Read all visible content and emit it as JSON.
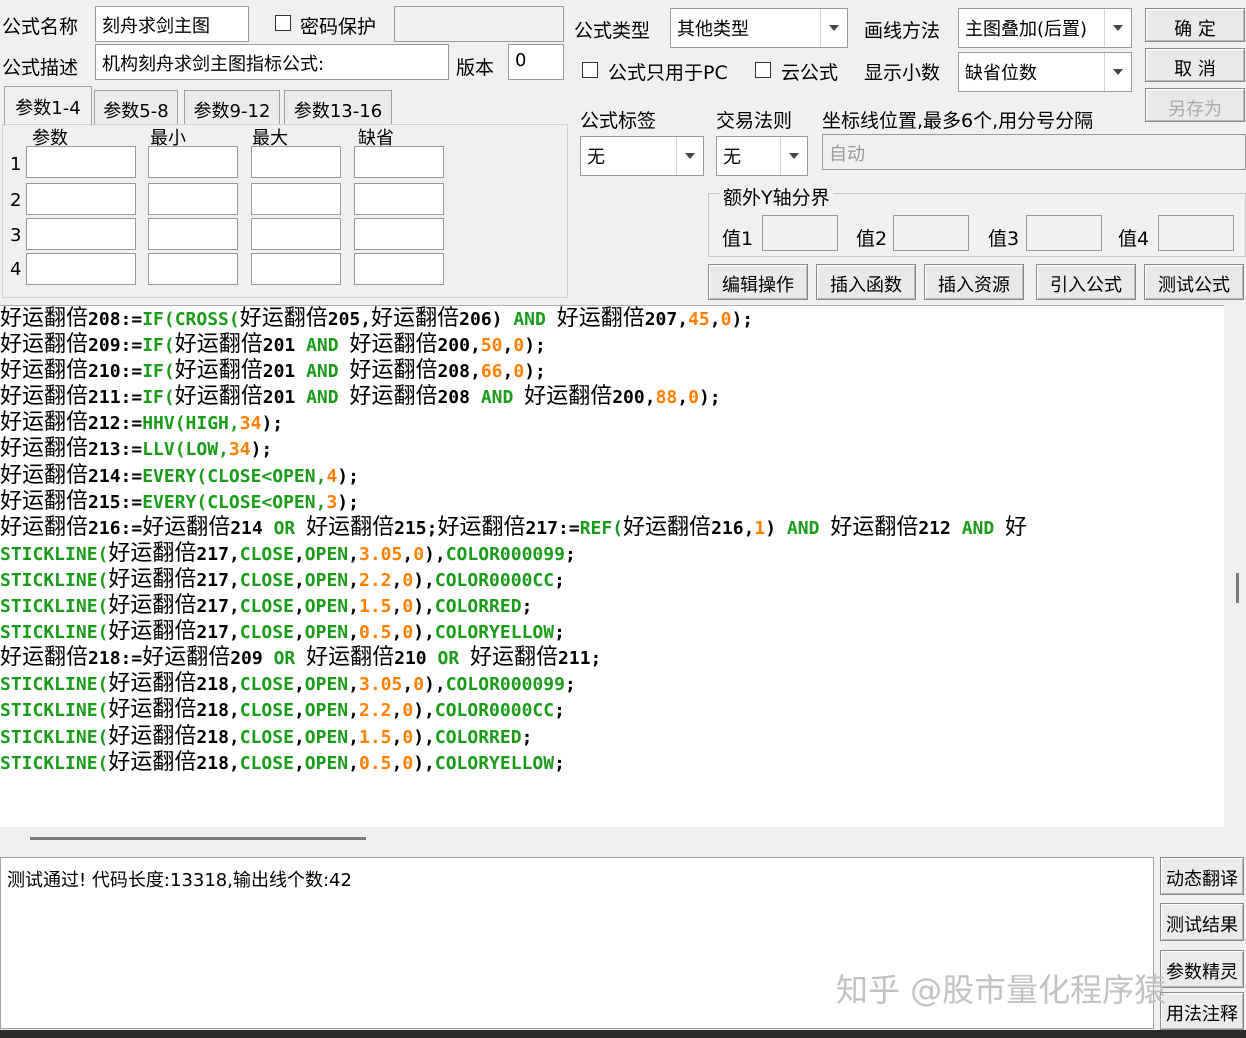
{
  "form": {
    "name_label": "公式名称",
    "name_value": "刻舟求剑主图",
    "password_label": "密码保护",
    "password_checked": false,
    "desc_label": "公式描述",
    "desc_value": "机构刻舟求剑主图指标公式:",
    "version_label": "版本",
    "version_value": "0",
    "type_label": "公式类型",
    "type_value": "其他类型",
    "draw_label": "画线方法",
    "draw_value": "主图叠加(后置)",
    "pc_only_label": "公式只用于PC",
    "pc_only_checked": false,
    "cloud_label": "云公式",
    "cloud_checked": false,
    "decimals_label": "显示小数",
    "decimals_value": "缺省位数",
    "tag_label": "公式标签",
    "tag_value": "无",
    "trade_label": "交易法则",
    "trade_value": "无",
    "axis_label": "坐标线位置,最多6个,用分号分隔",
    "axis_value": "自动",
    "extra_y_label": "额外Y轴分界",
    "extra_y_values": [
      "值1",
      "值2",
      "值3",
      "值4"
    ]
  },
  "buttons": {
    "ok": "确 定",
    "cancel": "取 消",
    "save_as": "另存为",
    "edit_ops": "编辑操作",
    "insert_func": "插入函数",
    "insert_res": "插入资源",
    "import_formula": "引入公式",
    "test_formula": "测试公式"
  },
  "params": {
    "tabs": [
      "参数1-4",
      "参数5-8",
      "参数9-12",
      "参数13-16"
    ],
    "active_tab": 0,
    "headers": [
      "参数",
      "最小",
      "最大",
      "缺省"
    ],
    "rows": [
      "1",
      "2",
      "3",
      "4"
    ]
  },
  "code_lines": [
    [
      [
        "t",
        "好运翻倍208:="
      ],
      [
        "f",
        "IF(CROSS("
      ],
      [
        "t",
        "好运翻倍205,好运翻倍206) "
      ],
      [
        "f",
        "AND"
      ],
      [
        "t",
        " 好运翻倍207,"
      ],
      [
        "n",
        "45"
      ],
      [
        "t",
        ","
      ],
      [
        "n",
        "0"
      ],
      [
        "t",
        ");"
      ]
    ],
    [
      [
        "t",
        "好运翻倍209:="
      ],
      [
        "f",
        "IF("
      ],
      [
        "t",
        "好运翻倍201 "
      ],
      [
        "f",
        "AND"
      ],
      [
        "t",
        " 好运翻倍200,"
      ],
      [
        "n",
        "50"
      ],
      [
        "t",
        ","
      ],
      [
        "n",
        "0"
      ],
      [
        "t",
        ");"
      ]
    ],
    [
      [
        "t",
        "好运翻倍210:="
      ],
      [
        "f",
        "IF("
      ],
      [
        "t",
        "好运翻倍201 "
      ],
      [
        "f",
        "AND"
      ],
      [
        "t",
        " 好运翻倍208,"
      ],
      [
        "n",
        "66"
      ],
      [
        "t",
        ","
      ],
      [
        "n",
        "0"
      ],
      [
        "t",
        ");"
      ]
    ],
    [
      [
        "t",
        "好运翻倍211:="
      ],
      [
        "f",
        "IF("
      ],
      [
        "t",
        "好运翻倍201 "
      ],
      [
        "f",
        "AND"
      ],
      [
        "t",
        " 好运翻倍208 "
      ],
      [
        "f",
        "AND"
      ],
      [
        "t",
        " 好运翻倍200,"
      ],
      [
        "n",
        "88"
      ],
      [
        "t",
        ","
      ],
      [
        "n",
        "0"
      ],
      [
        "t",
        ");"
      ]
    ],
    [
      [
        "t",
        "好运翻倍212:="
      ],
      [
        "f",
        "HHV(HIGH,"
      ],
      [
        "n",
        "34"
      ],
      [
        "t",
        ");"
      ]
    ],
    [
      [
        "t",
        "好运翻倍213:="
      ],
      [
        "f",
        "LLV(LOW,"
      ],
      [
        "n",
        "34"
      ],
      [
        "t",
        ");"
      ]
    ],
    [
      [
        "t",
        "好运翻倍214:="
      ],
      [
        "f",
        "EVERY(CLOSE<OPEN,"
      ],
      [
        "n",
        "4"
      ],
      [
        "t",
        ");"
      ]
    ],
    [
      [
        "t",
        "好运翻倍215:="
      ],
      [
        "f",
        "EVERY(CLOSE<OPEN,"
      ],
      [
        "n",
        "3"
      ],
      [
        "t",
        ");"
      ]
    ],
    [
      [
        "t",
        "好运翻倍216:=好运翻倍214 "
      ],
      [
        "f",
        "OR"
      ],
      [
        "t",
        " 好运翻倍215;好运翻倍217:="
      ],
      [
        "f",
        "REF("
      ],
      [
        "t",
        "好运翻倍216,"
      ],
      [
        "n",
        "1"
      ],
      [
        "t",
        ") "
      ],
      [
        "f",
        "AND"
      ],
      [
        "t",
        " 好运翻倍212 "
      ],
      [
        "f",
        "AND"
      ],
      [
        "t",
        " 好"
      ]
    ],
    [
      [
        "f",
        "STICKLINE("
      ],
      [
        "t",
        "好运翻倍217,"
      ],
      [
        "f",
        "CLOSE"
      ],
      [
        "t",
        ","
      ],
      [
        "f",
        "OPEN"
      ],
      [
        "t",
        ","
      ],
      [
        "n",
        "3.05"
      ],
      [
        "t",
        ","
      ],
      [
        "n",
        "0"
      ],
      [
        "t",
        "),"
      ],
      [
        "f",
        "COLOR000099"
      ],
      [
        "t",
        ";"
      ]
    ],
    [
      [
        "f",
        "STICKLINE("
      ],
      [
        "t",
        "好运翻倍217,"
      ],
      [
        "f",
        "CLOSE"
      ],
      [
        "t",
        ","
      ],
      [
        "f",
        "OPEN"
      ],
      [
        "t",
        ","
      ],
      [
        "n",
        "2.2"
      ],
      [
        "t",
        ","
      ],
      [
        "n",
        "0"
      ],
      [
        "t",
        "),"
      ],
      [
        "f",
        "COLOR0000CC"
      ],
      [
        "t",
        ";"
      ]
    ],
    [
      [
        "f",
        "STICKLINE("
      ],
      [
        "t",
        "好运翻倍217,"
      ],
      [
        "f",
        "CLOSE"
      ],
      [
        "t",
        ","
      ],
      [
        "f",
        "OPEN"
      ],
      [
        "t",
        ","
      ],
      [
        "n",
        "1.5"
      ],
      [
        "t",
        ","
      ],
      [
        "n",
        "0"
      ],
      [
        "t",
        "),"
      ],
      [
        "f",
        "COLORRED"
      ],
      [
        "t",
        ";"
      ]
    ],
    [
      [
        "f",
        "STICKLINE("
      ],
      [
        "t",
        "好运翻倍217,"
      ],
      [
        "f",
        "CLOSE"
      ],
      [
        "t",
        ","
      ],
      [
        "f",
        "OPEN"
      ],
      [
        "t",
        ","
      ],
      [
        "n",
        "0.5"
      ],
      [
        "t",
        ","
      ],
      [
        "n",
        "0"
      ],
      [
        "t",
        "),"
      ],
      [
        "f",
        "COLORYELLOW"
      ],
      [
        "t",
        ";"
      ]
    ],
    [
      [
        "t",
        "好运翻倍218:=好运翻倍209 "
      ],
      [
        "f",
        "OR"
      ],
      [
        "t",
        " 好运翻倍210 "
      ],
      [
        "f",
        "OR"
      ],
      [
        "t",
        " 好运翻倍211;"
      ]
    ],
    [
      [
        "f",
        "STICKLINE("
      ],
      [
        "t",
        "好运翻倍218,"
      ],
      [
        "f",
        "CLOSE"
      ],
      [
        "t",
        ","
      ],
      [
        "f",
        "OPEN"
      ],
      [
        "t",
        ","
      ],
      [
        "n",
        "3.05"
      ],
      [
        "t",
        ","
      ],
      [
        "n",
        "0"
      ],
      [
        "t",
        "),"
      ],
      [
        "f",
        "COLOR000099"
      ],
      [
        "t",
        ";"
      ]
    ],
    [
      [
        "f",
        "STICKLINE("
      ],
      [
        "t",
        "好运翻倍218,"
      ],
      [
        "f",
        "CLOSE"
      ],
      [
        "t",
        ","
      ],
      [
        "f",
        "OPEN"
      ],
      [
        "t",
        ","
      ],
      [
        "n",
        "2.2"
      ],
      [
        "t",
        ","
      ],
      [
        "n",
        "0"
      ],
      [
        "t",
        "),"
      ],
      [
        "f",
        "COLOR0000CC"
      ],
      [
        "t",
        ";"
      ]
    ],
    [
      [
        "f",
        "STICKLINE("
      ],
      [
        "t",
        "好运翻倍218,"
      ],
      [
        "f",
        "CLOSE"
      ],
      [
        "t",
        ","
      ],
      [
        "f",
        "OPEN"
      ],
      [
        "t",
        ","
      ],
      [
        "n",
        "1.5"
      ],
      [
        "t",
        ","
      ],
      [
        "n",
        "0"
      ],
      [
        "t",
        "),"
      ],
      [
        "f",
        "COLORRED"
      ],
      [
        "t",
        ";"
      ]
    ],
    [
      [
        "f",
        "STICKLINE("
      ],
      [
        "t",
        "好运翻倍218,"
      ],
      [
        "f",
        "CLOSE"
      ],
      [
        "t",
        ","
      ],
      [
        "f",
        "OPEN"
      ],
      [
        "t",
        ","
      ],
      [
        "n",
        "0.5"
      ],
      [
        "t",
        ","
      ],
      [
        "n",
        "0"
      ],
      [
        "t",
        "),"
      ],
      [
        "f",
        "COLORYELLOW"
      ],
      [
        "t",
        ";"
      ]
    ]
  ],
  "colors": {
    "keyword": "#1a9c1a",
    "number": "#ff8000",
    "text": "#000000"
  },
  "status_text": "测试通过! 代码长度:13318,输出线个数:42",
  "side_buttons": [
    "动态翻译",
    "测试结果",
    "参数精灵",
    "用法注释"
  ],
  "watermark": "知乎 @股市量化程序猿"
}
